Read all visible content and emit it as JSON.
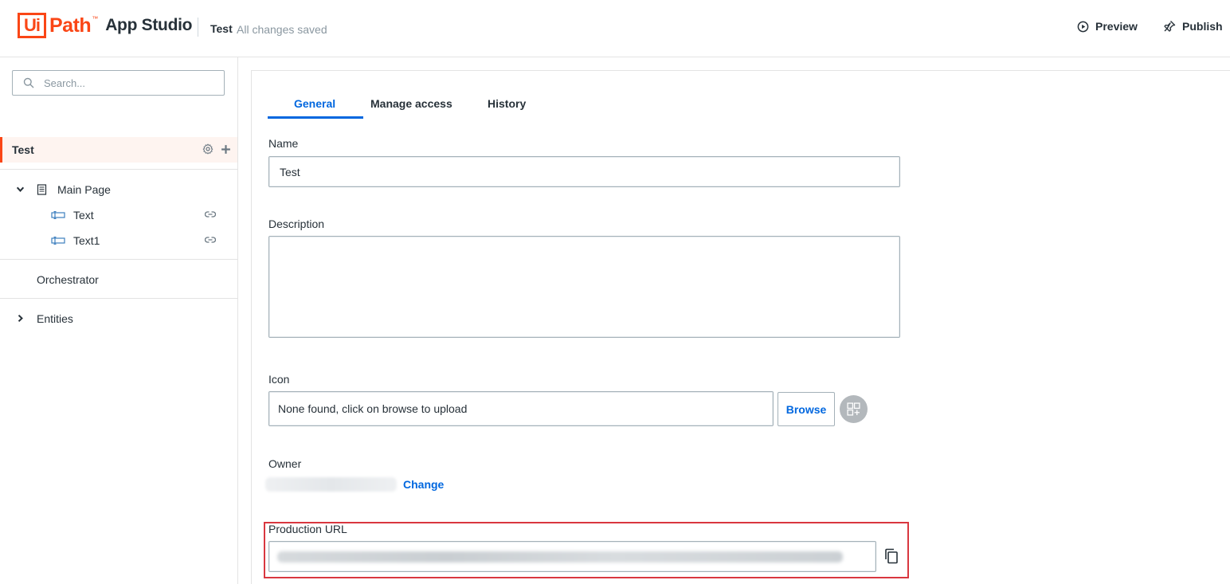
{
  "header": {
    "logo_ui": "Ui",
    "logo_path": "Path",
    "logo_tm": "™",
    "product": "App Studio",
    "app_name": "Test",
    "save_status": "All changes saved",
    "preview_label": "Preview",
    "publish_label": "Publish"
  },
  "sidebar": {
    "search_placeholder": "Search...",
    "root": {
      "label": "Test",
      "icons": [
        "gear-icon",
        "plus-icon"
      ]
    },
    "main_page": {
      "label": "Main Page",
      "expanded": true
    },
    "children": [
      {
        "label": "Text",
        "icon": "text-control-icon"
      },
      {
        "label": "Text1",
        "icon": "text-control-icon"
      }
    ],
    "orchestrator": "Orchestrator",
    "entities": {
      "label": "Entities",
      "expanded": false
    }
  },
  "tabs": {
    "general": "General",
    "manage_access": "Manage access",
    "history": "History",
    "active": "General"
  },
  "form": {
    "name_label": "Name",
    "name_value": "Test",
    "description_label": "Description",
    "description_value": "",
    "icon_label": "Icon",
    "icon_value": "None found, click on browse to upload",
    "browse_label": "Browse",
    "owner_label": "Owner",
    "change_label": "Change",
    "production_url_label": "Production URL"
  },
  "colors": {
    "brand": "#fa4616",
    "accent": "#0067df",
    "highlight": "#d9373f"
  }
}
